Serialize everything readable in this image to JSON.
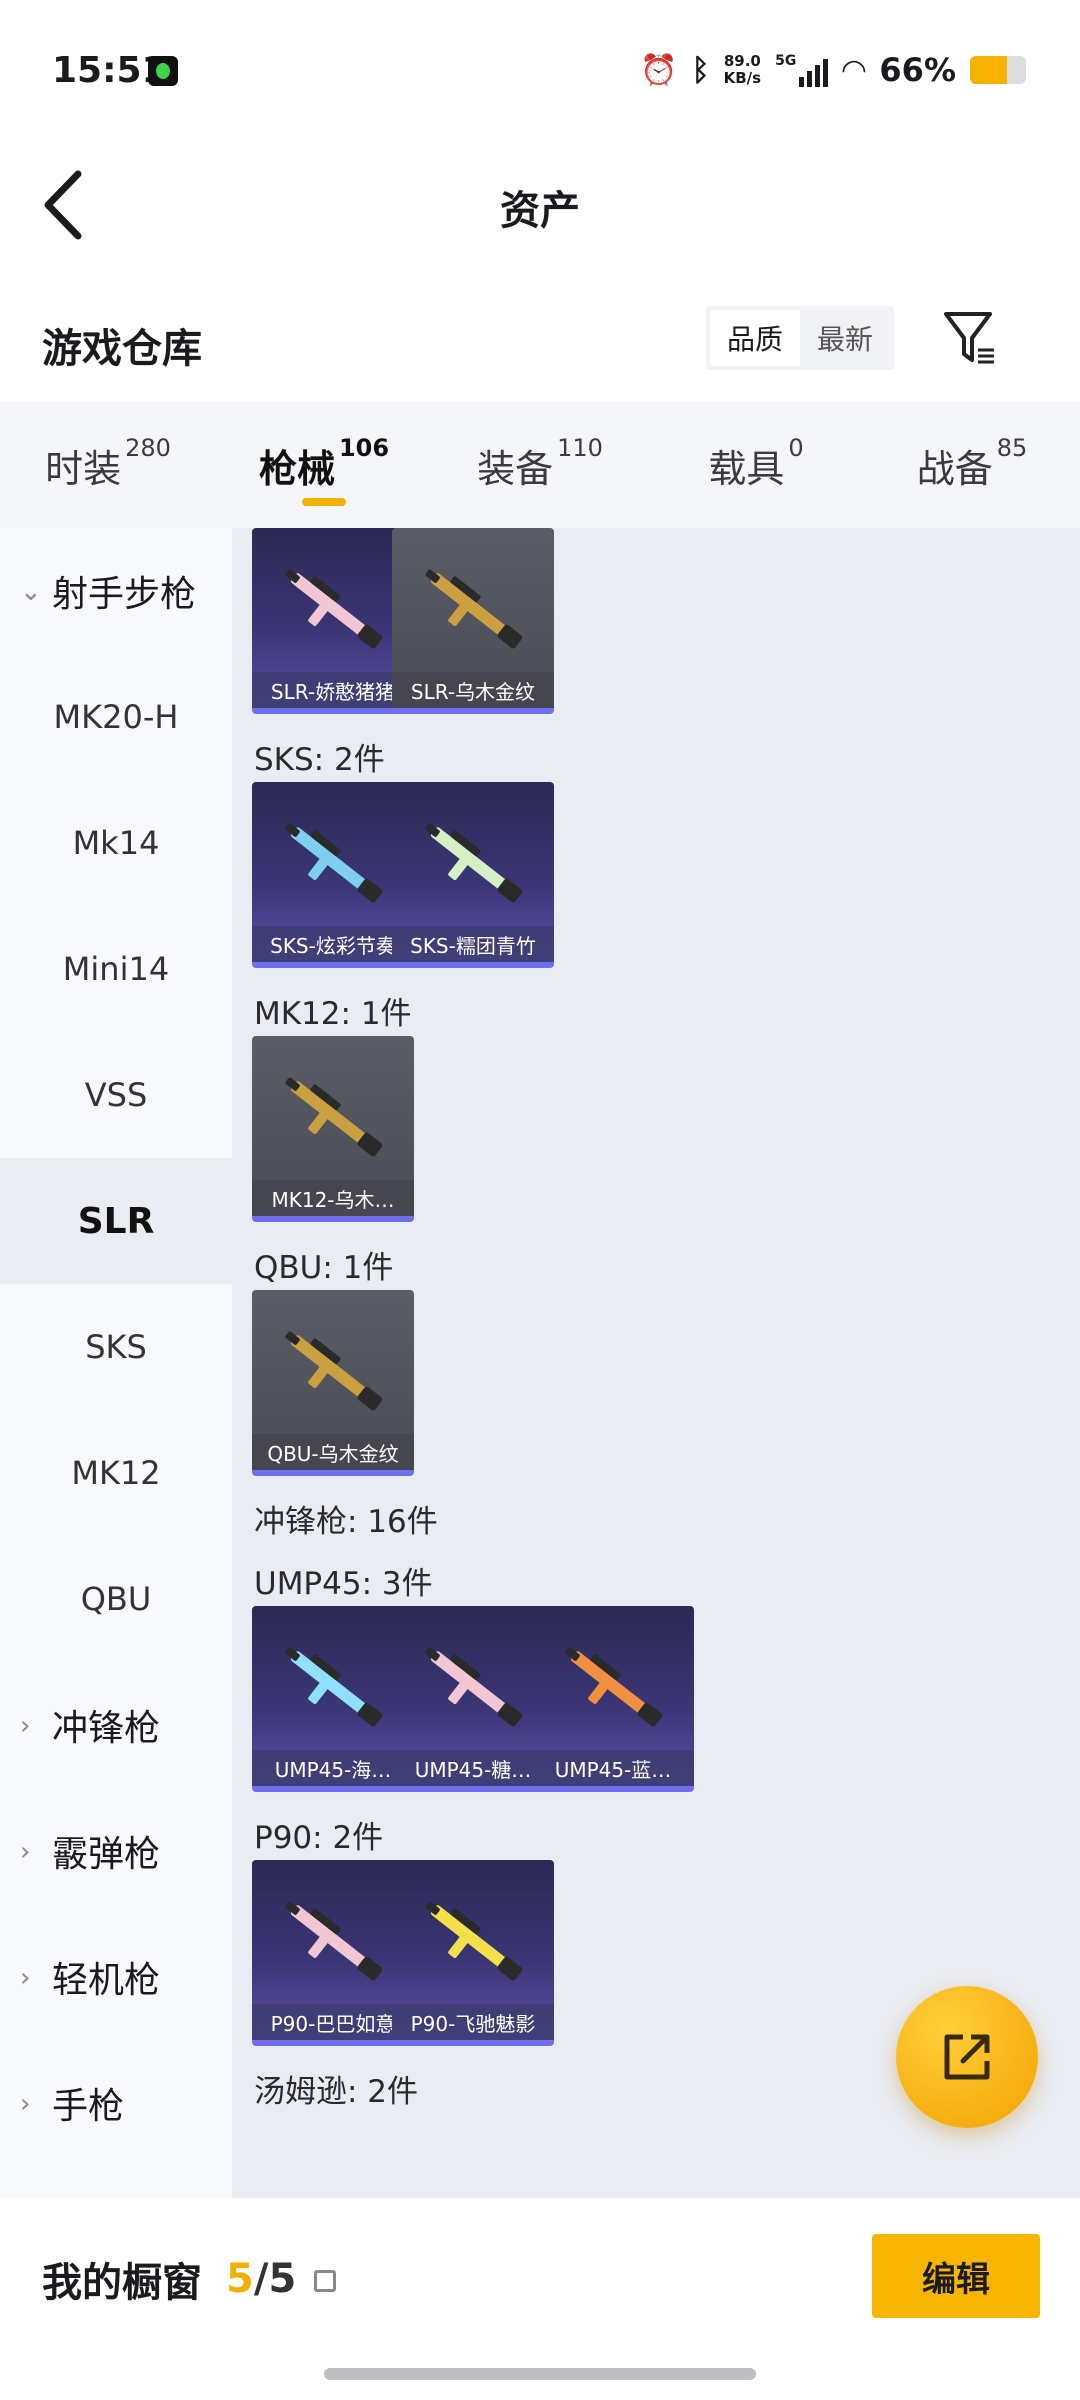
{
  "status": {
    "time": "15:51",
    "speed_top": "89.0",
    "speed_unit": "KB/s",
    "network": "5G",
    "battery": "66%",
    "battery_level": 0.66
  },
  "nav": {
    "title": "资产"
  },
  "section": {
    "title": "游戏仓库",
    "sort": [
      "品质",
      "最新"
    ],
    "active_sort": "品质"
  },
  "tabs": [
    {
      "label": "时装",
      "count": "280"
    },
    {
      "label": "枪械",
      "count": "106",
      "active": true
    },
    {
      "label": "装备",
      "count": "110"
    },
    {
      "label": "载具",
      "count": "0"
    },
    {
      "label": "战备",
      "count": "85"
    }
  ],
  "sidebar": [
    {
      "label": "射手步枪",
      "group": true,
      "expanded": true
    },
    {
      "label": "MK20-H"
    },
    {
      "label": "Mk14"
    },
    {
      "label": "Mini14"
    },
    {
      "label": "VSS"
    },
    {
      "label": "SLR",
      "selected": true
    },
    {
      "label": "SKS"
    },
    {
      "label": "MK12"
    },
    {
      "label": "QBU"
    },
    {
      "label": "冲锋枪",
      "group": true
    },
    {
      "label": "霰弹枪",
      "group": true
    },
    {
      "label": "轻机枪",
      "group": true
    },
    {
      "label": "手枪",
      "group": true
    }
  ],
  "content": {
    "groups": [
      {
        "label": "",
        "items": [
          {
            "name": "SLR-娇憨猪猪",
            "style": "purple",
            "gun": "pink"
          },
          {
            "name": "SLR-乌木金纹",
            "style": "gray",
            "gun": "gold"
          }
        ]
      },
      {
        "label": "SKS: 2件",
        "items": [
          {
            "name": "SKS-炫彩节奏",
            "style": "purple",
            "gun": "blue"
          },
          {
            "name": "SKS-糯团青竹",
            "style": "purple",
            "gun": "green"
          }
        ]
      },
      {
        "label": "MK12: 1件",
        "items": [
          {
            "name": "MK12-乌木…",
            "style": "gray",
            "gun": "gold"
          }
        ]
      },
      {
        "label": "QBU: 1件",
        "items": [
          {
            "name": "QBU-乌木金纹",
            "style": "gray",
            "gun": "gold"
          }
        ]
      },
      {
        "label": "冲锋枪: 16件",
        "items": []
      },
      {
        "label": "UMP45: 3件",
        "items": [
          {
            "name": "UMP45-海…",
            "style": "purple",
            "gun": "cyan"
          },
          {
            "name": "UMP45-糖…",
            "style": "purple",
            "gun": "pink"
          },
          {
            "name": "UMP45-蓝…",
            "style": "purple",
            "gun": "orange"
          }
        ]
      },
      {
        "label": "P90: 2件",
        "items": [
          {
            "name": "P90-巴巴如意",
            "style": "purple",
            "gun": "pink"
          },
          {
            "name": "P90-飞驰魅影",
            "style": "purple",
            "gun": "yellow"
          }
        ]
      },
      {
        "label": "汤姆逊: 2件",
        "items": []
      }
    ]
  },
  "bottom": {
    "showcase_label": "我的橱窗",
    "current": "5",
    "separator": "/",
    "total": "5",
    "edit_label": "编辑"
  },
  "colors": {
    "accent": "#f5b200",
    "card_purple": "#3a3574",
    "card_gray": "#52545e"
  }
}
